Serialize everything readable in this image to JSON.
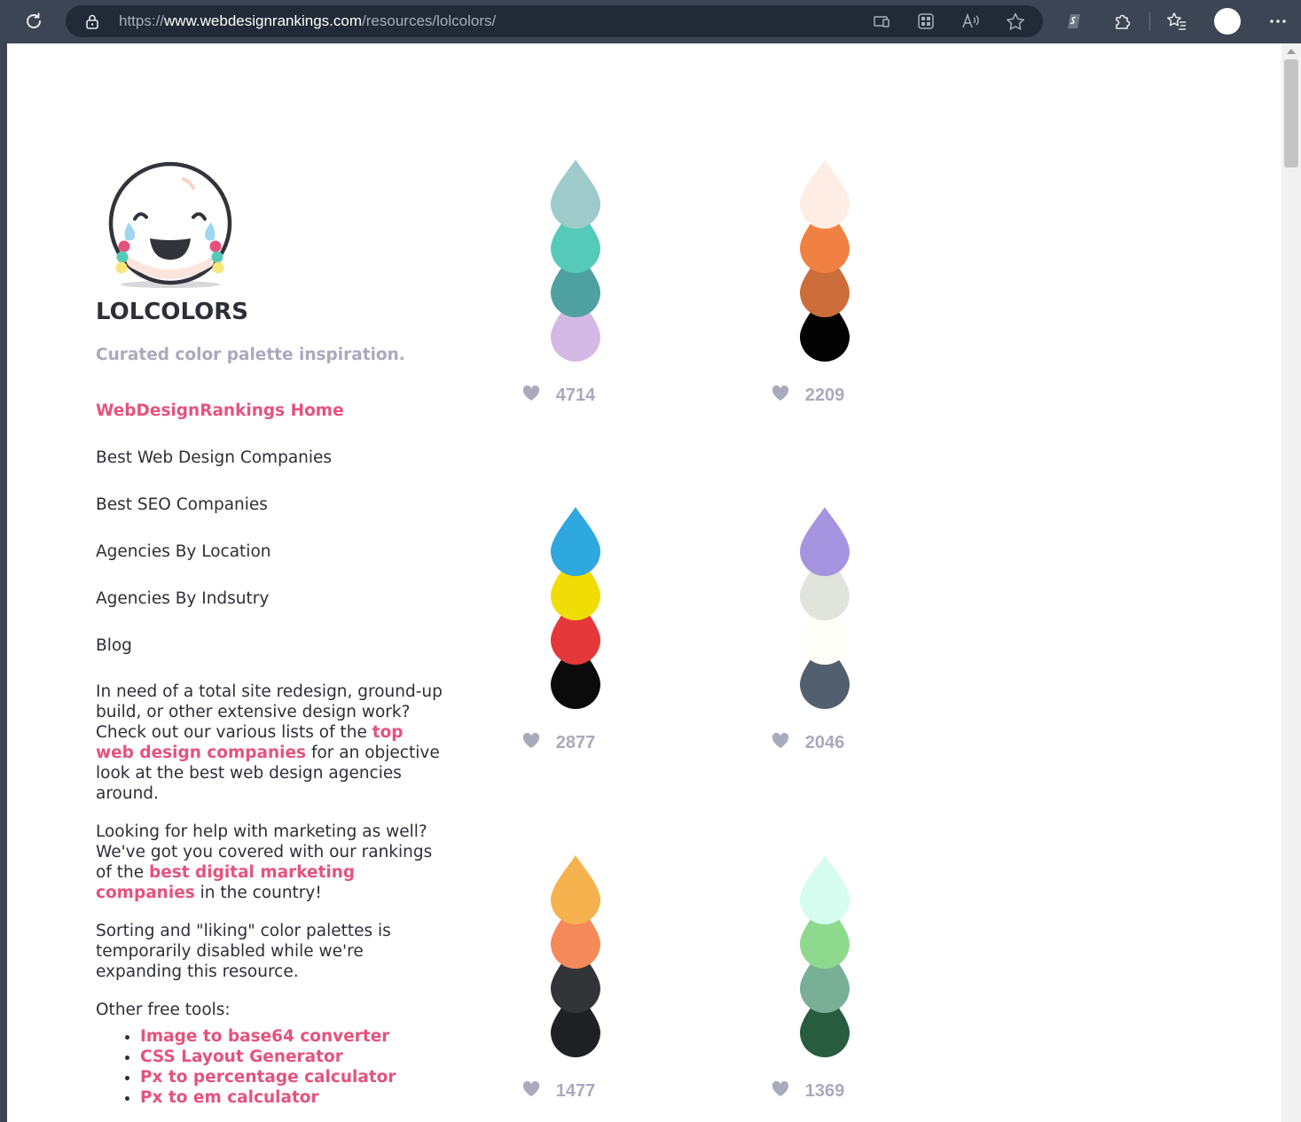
{
  "browser": {
    "url_prefix": "https://",
    "url_host": "www.webdesignrankings.com",
    "url_path": "/resources/lolcolors/"
  },
  "site": {
    "title": "LOLCOLORS",
    "tagline": "Curated color palette inspiration."
  },
  "nav": [
    {
      "label": "WebDesignRankings Home"
    },
    {
      "label": "Best Web Design Companies"
    },
    {
      "label": "Best SEO Companies"
    },
    {
      "label": "Agencies By Location"
    },
    {
      "label": "Agencies By Indsutry"
    },
    {
      "label": "Blog"
    }
  ],
  "blurb": {
    "p1_a": "In need of a total site redesign, ground-up build, or other extensive design work? Check out our various lists of the ",
    "p1_link": "top web design companies",
    "p1_b": " for an objective look at the best web design agencies around.",
    "p2_a": "Looking for help with marketing as well? We've got you covered with our rankings of the ",
    "p2_link": "best digital marketing companies",
    "p2_b": " in the country!",
    "p3": "Sorting and \"liking\" color palettes is temporarily disabled while we're expanding this resource.",
    "p4": "Other free tools:",
    "tools": [
      "Image to base64 converter",
      "CSS Layout Generator",
      "Px to percentage calculator",
      "Px to em calculator"
    ]
  },
  "palettes": [
    {
      "colors": [
        "#9ecbca",
        "#55cab9",
        "#4fa0a0",
        "#d4b9e4"
      ],
      "likes": "4714"
    },
    {
      "colors": [
        "#fdede4",
        "#f08142",
        "#cd6d39",
        "#020202"
      ],
      "likes": "2209"
    },
    {
      "colors": [
        "#2fa7df",
        "#efdd05",
        "#e5383b",
        "#0b0b0b"
      ],
      "likes": "2877"
    },
    {
      "colors": [
        "#a595e0",
        "#e1e3dd",
        "#fdfef7",
        "#525f6e"
      ],
      "likes": "2046"
    },
    {
      "colors": [
        "#f5b24e",
        "#f5895a",
        "#333438",
        "#1f2023"
      ],
      "likes": "1477"
    },
    {
      "colors": [
        "#d6fbef",
        "#8ed98e",
        "#7aaf97",
        "#275c3e"
      ],
      "likes": "1369"
    }
  ]
}
